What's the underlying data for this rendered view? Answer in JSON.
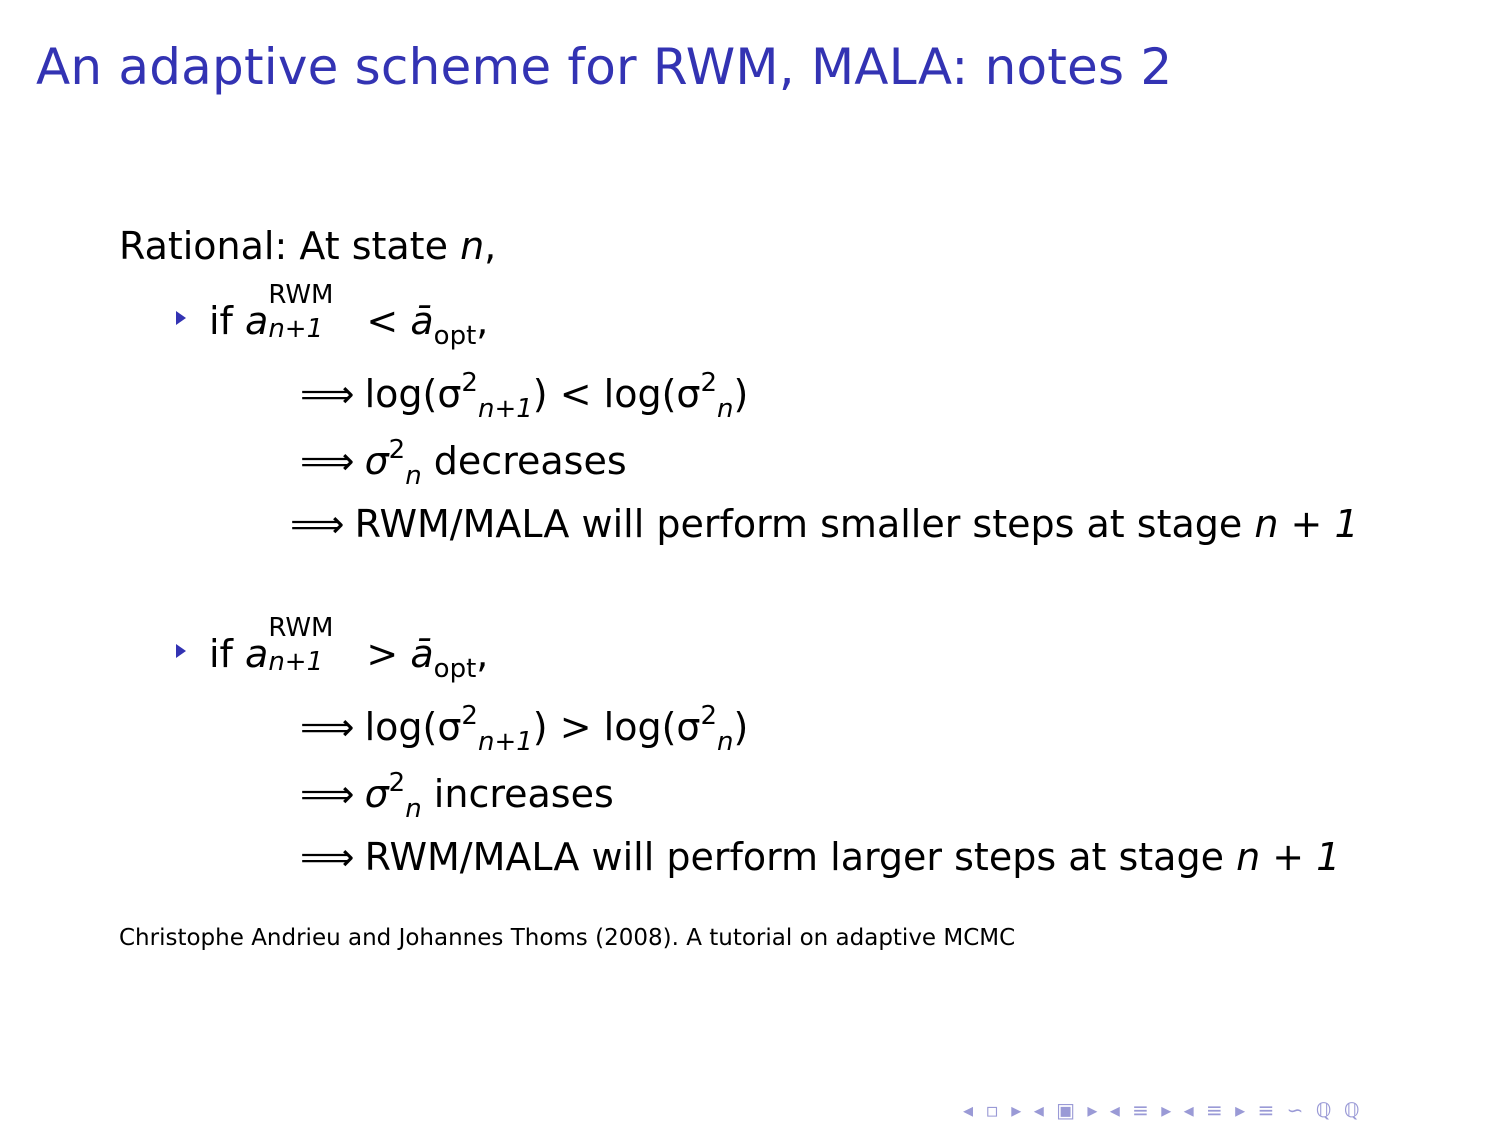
{
  "slide": {
    "title": "An adaptive scheme for RWM, MALA: notes 2",
    "intro": {
      "label": "Rational:",
      "text": "At state",
      "var": "n",
      "comma": ","
    },
    "block1": {
      "if_word": "if",
      "cond_rel": "<",
      "line1": {
        "arrow": "⟹",
        "lhs": "log(σ",
        "rel": "<",
        "rhs": "log(σ"
      },
      "line2": {
        "arrow": "⟹",
        "word": "decreases"
      },
      "line3": {
        "arrow": "⟹",
        "text": "RWM/MALA will perform smaller steps at stage",
        "tail": "n + 1"
      }
    },
    "block2": {
      "if_word": "if",
      "cond_rel": ">",
      "line1": {
        "arrow": "⟹",
        "lhs": "log(σ",
        "rel": ">",
        "rhs": "log(σ"
      },
      "line2": {
        "arrow": "⟹",
        "word": "increases"
      },
      "line3": {
        "arrow": "⟹",
        "text": "RWM/MALA will perform larger steps at stage",
        "tail": "n + 1"
      }
    },
    "math": {
      "a": "a",
      "sup_rwm": "RWM",
      "sub_n1": "n+1",
      "abar": "ā",
      "sub_opt": "opt",
      "sigma": "σ",
      "two": "2",
      "n": "n",
      "close": ")"
    },
    "reference": "Christophe Andrieu and Johannes Thoms (2008). A tutorial on adaptive MCMC",
    "nav": "◂ ▫ ▸ ◂ ▣ ▸ ◂ ≡ ▸ ◂ ≡ ▸   ≡   ∽ ℚ ℚ"
  },
  "colors": {
    "title": "#3333b3",
    "bullet": "#3333b3",
    "nav": "#9a9ad6"
  }
}
